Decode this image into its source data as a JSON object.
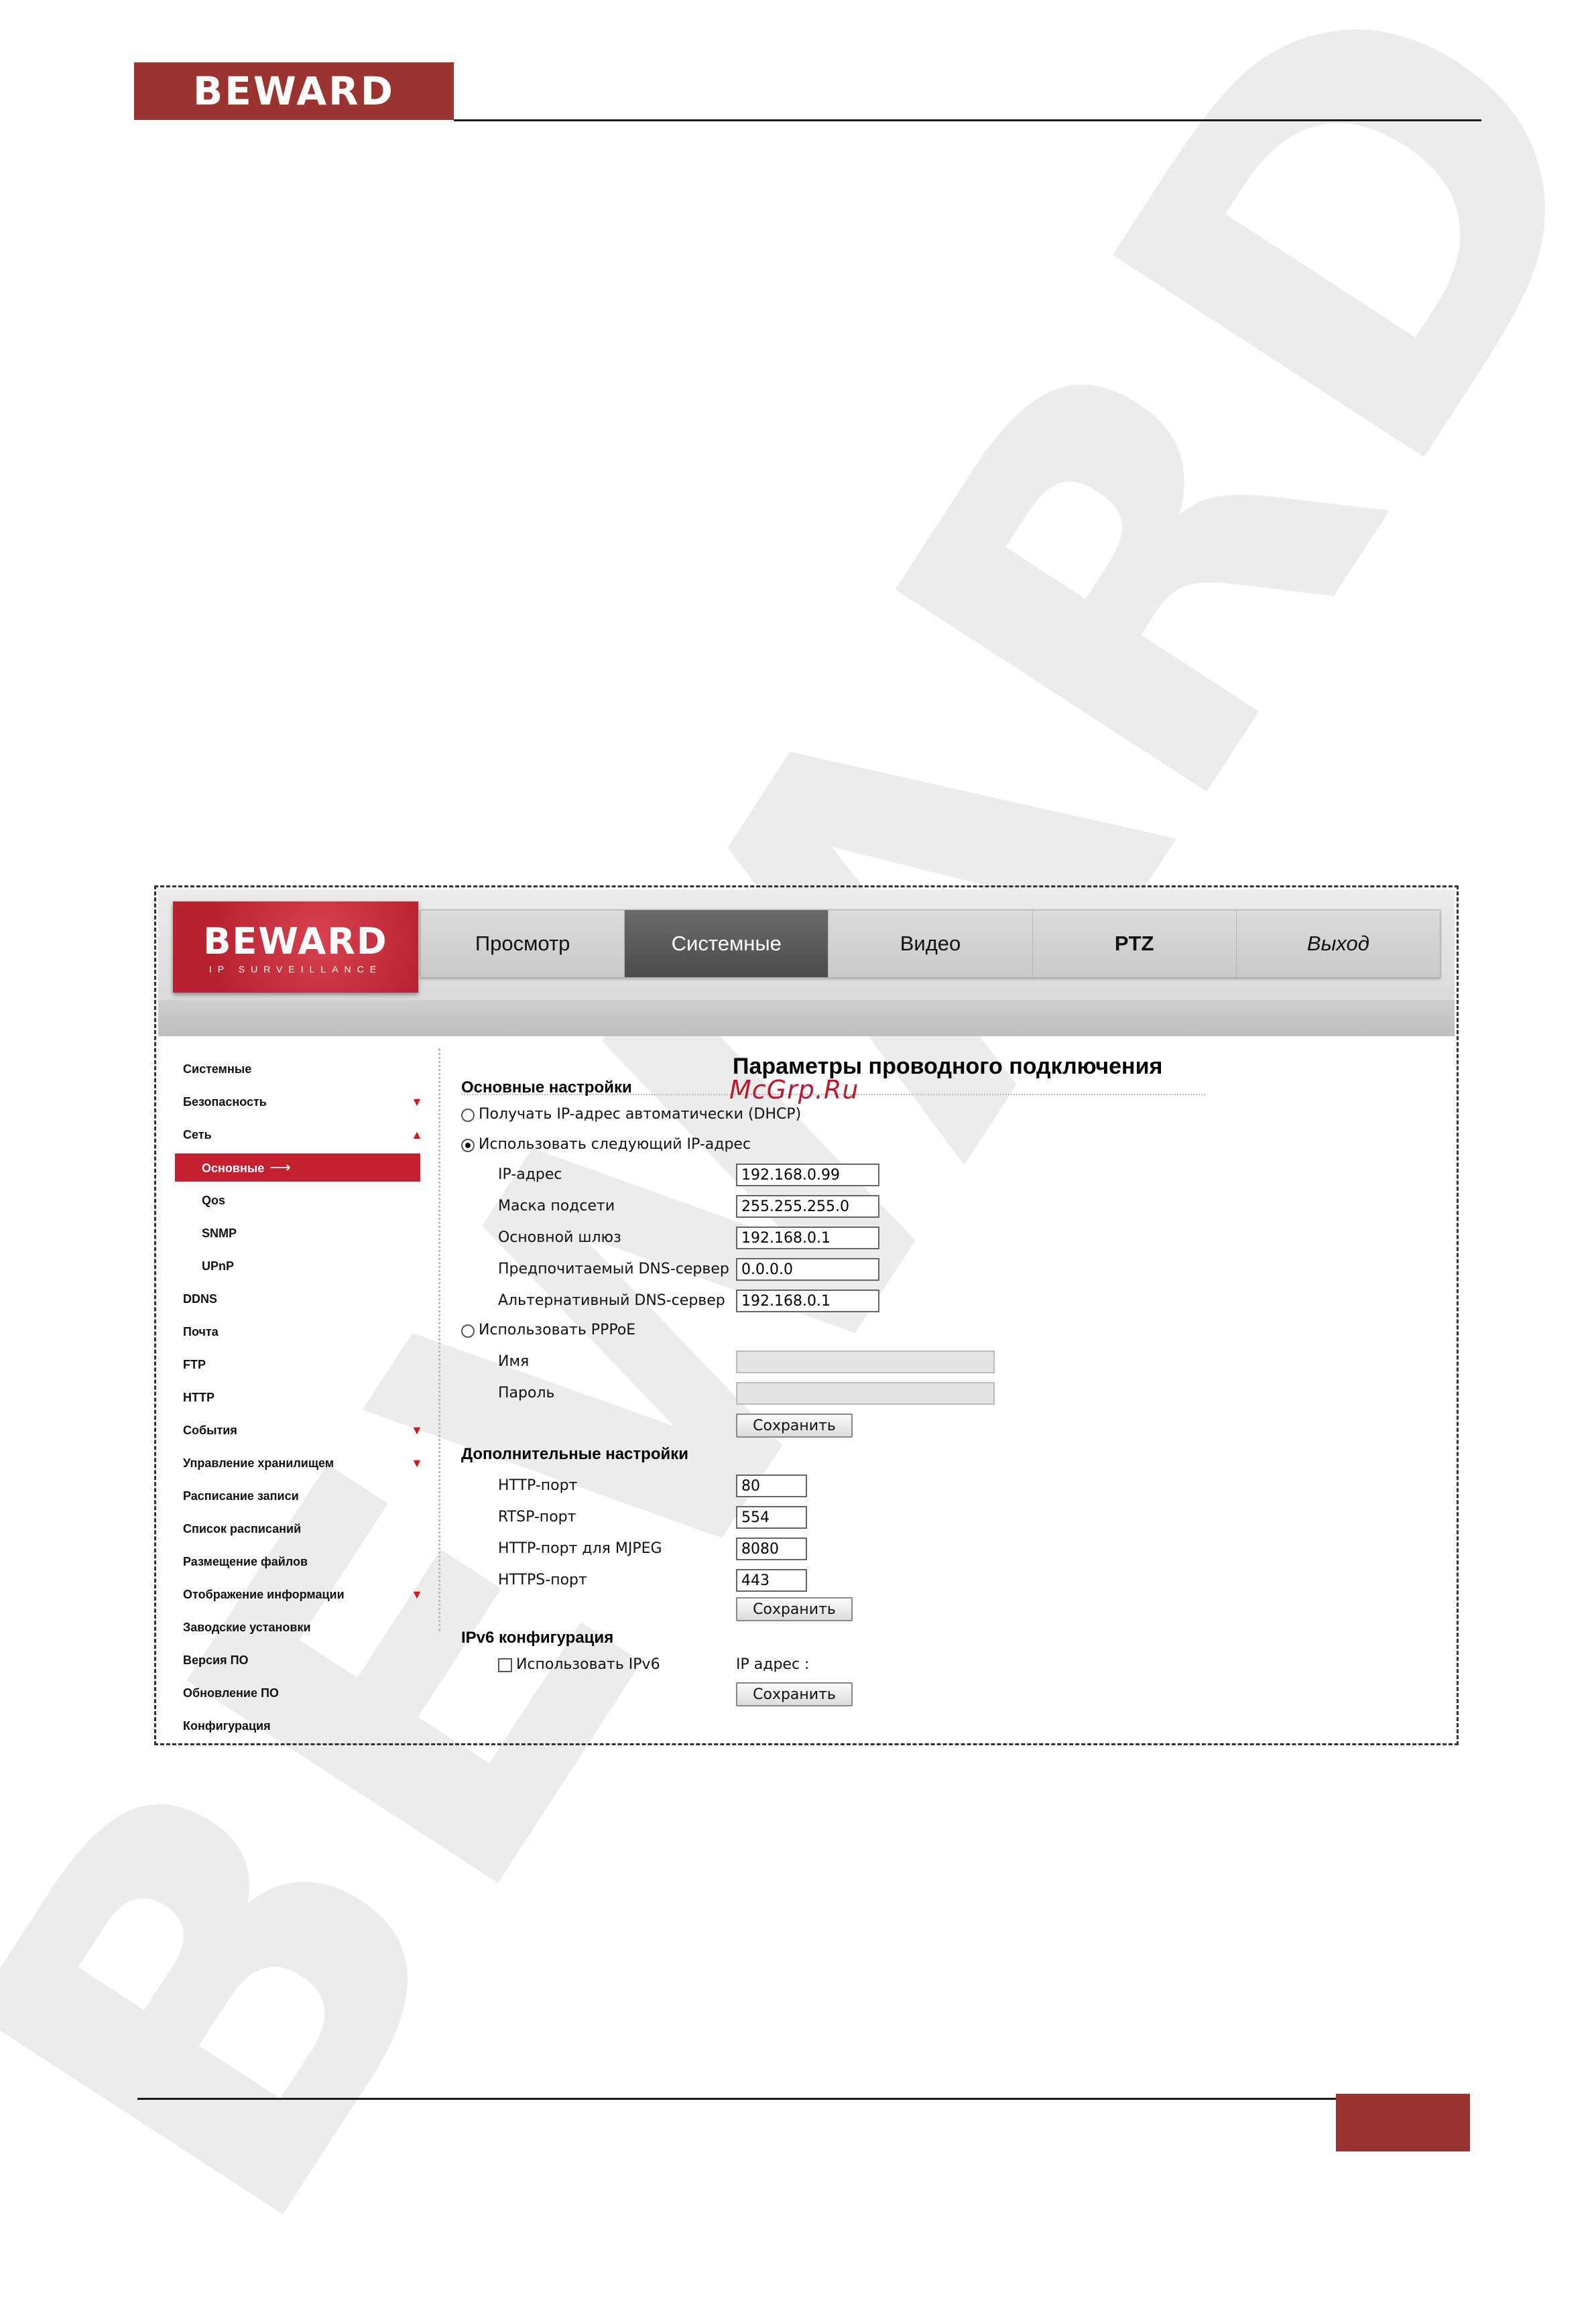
{
  "doc": {
    "logo_text": "BEWARD"
  },
  "app": {
    "logo_text": "BEWARD",
    "logo_sub": "IP SURVEILLANCE",
    "nav": [
      {
        "label": "Просмотр"
      },
      {
        "label": "Системные"
      },
      {
        "label": "Видео"
      },
      {
        "label": "PTZ"
      },
      {
        "label": "Выход"
      }
    ],
    "active_tab": "Системные"
  },
  "sidebar": {
    "items": [
      {
        "label": "Системные"
      },
      {
        "label": "Безопасность",
        "indicator": "▼"
      },
      {
        "label": "Сеть",
        "indicator": "▲"
      },
      {
        "label": "Основные",
        "arrow": "⟶"
      },
      {
        "label": "Qos"
      },
      {
        "label": "SNMP"
      },
      {
        "label": "UPnP"
      },
      {
        "label": "DDNS"
      },
      {
        "label": "Почта"
      },
      {
        "label": "FTP"
      },
      {
        "label": "HTTP"
      },
      {
        "label": "События",
        "indicator": "▼"
      },
      {
        "label": "Управление хранилищем",
        "indicator": "▼"
      },
      {
        "label": "Расписание записи"
      },
      {
        "label": "Список расписаний"
      },
      {
        "label": "Размещение файлов"
      },
      {
        "label": "Отображение информации",
        "indicator": "▼"
      },
      {
        "label": "Заводские установки"
      },
      {
        "label": "Версия ПО"
      },
      {
        "label": "Обновление ПО"
      },
      {
        "label": "Конфигурация"
      }
    ]
  },
  "main": {
    "title": "Параметры проводного подключения",
    "overlay": "McGrp.Ru",
    "basic": {
      "title": "Основные настройки",
      "dhcp_label": "Получать IP-адрес автоматически (DHCP)",
      "static_label": "Использовать следующий IP-адрес",
      "fields": [
        {
          "label": "IP-адрес",
          "value": "192.168.0.99"
        },
        {
          "label": "Маска подсети",
          "value": "255.255.255.0"
        },
        {
          "label": "Основной шлюз",
          "value": "192.168.0.1"
        },
        {
          "label": "Предпочитаемый DNS-сервер",
          "value": "0.0.0.0"
        },
        {
          "label": "Альтернативный DNS-сервер",
          "value": "192.168.0.1"
        }
      ],
      "pppoe_label": "Использовать PPPoE",
      "pppoe_fields": [
        {
          "label": "Имя",
          "value": ""
        },
        {
          "label": "Пароль",
          "value": ""
        }
      ],
      "save_label": "Сохранить"
    },
    "advanced": {
      "title": "Дополнительные настройки",
      "fields": [
        {
          "label": "HTTP-порт",
          "value": "80"
        },
        {
          "label": "RTSP-порт",
          "value": "554"
        },
        {
          "label": "HTTP-порт для MJPEG",
          "value": "8080"
        },
        {
          "label": "HTTPS-порт",
          "value": "443"
        }
      ],
      "save_label": "Сохранить"
    },
    "ipv6": {
      "title": "IPv6 конфигурация",
      "use_label": "Использовать IPv6",
      "ip_label": "IP адрес :",
      "save_label": "Сохранить"
    }
  },
  "colors": {
    "brand_red": "#9b3430",
    "menu_active": "#c42030"
  }
}
